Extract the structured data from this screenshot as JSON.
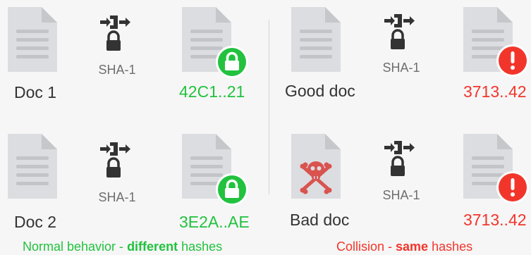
{
  "algorithm": "SHA-1",
  "colors": {
    "doc_fill": "#dcdde0",
    "doc_fold": "#c6c7ca",
    "doc_lines": "#c3c4c7",
    "ok_green": "#22c23f",
    "bad_red": "#f2352b",
    "skull": "#d9534f",
    "icon_dark": "#333333",
    "background": "#f6f6f6"
  },
  "normal": {
    "row1": {
      "doc_label": "Doc 1",
      "hash": "42C1..21"
    },
    "row2": {
      "doc_label": "Doc 2",
      "hash": "3E2A..AE"
    },
    "caption_prefix": "Normal behavior - ",
    "caption_bold": "different",
    "caption_suffix": " hashes"
  },
  "collision": {
    "row1": {
      "doc_label": "Good doc",
      "hash": "3713..42"
    },
    "row2": {
      "doc_label": "Bad doc",
      "hash": "3713..42"
    },
    "caption_prefix": "Collision - ",
    "caption_bold": "same",
    "caption_suffix": " hashes"
  },
  "icons": {
    "document": "document-icon",
    "hash_function": "hash-arrow-lock-icon",
    "success": "lock-badge-icon",
    "alert": "exclamation-badge-icon",
    "malicious": "skull-crossbones-icon"
  }
}
